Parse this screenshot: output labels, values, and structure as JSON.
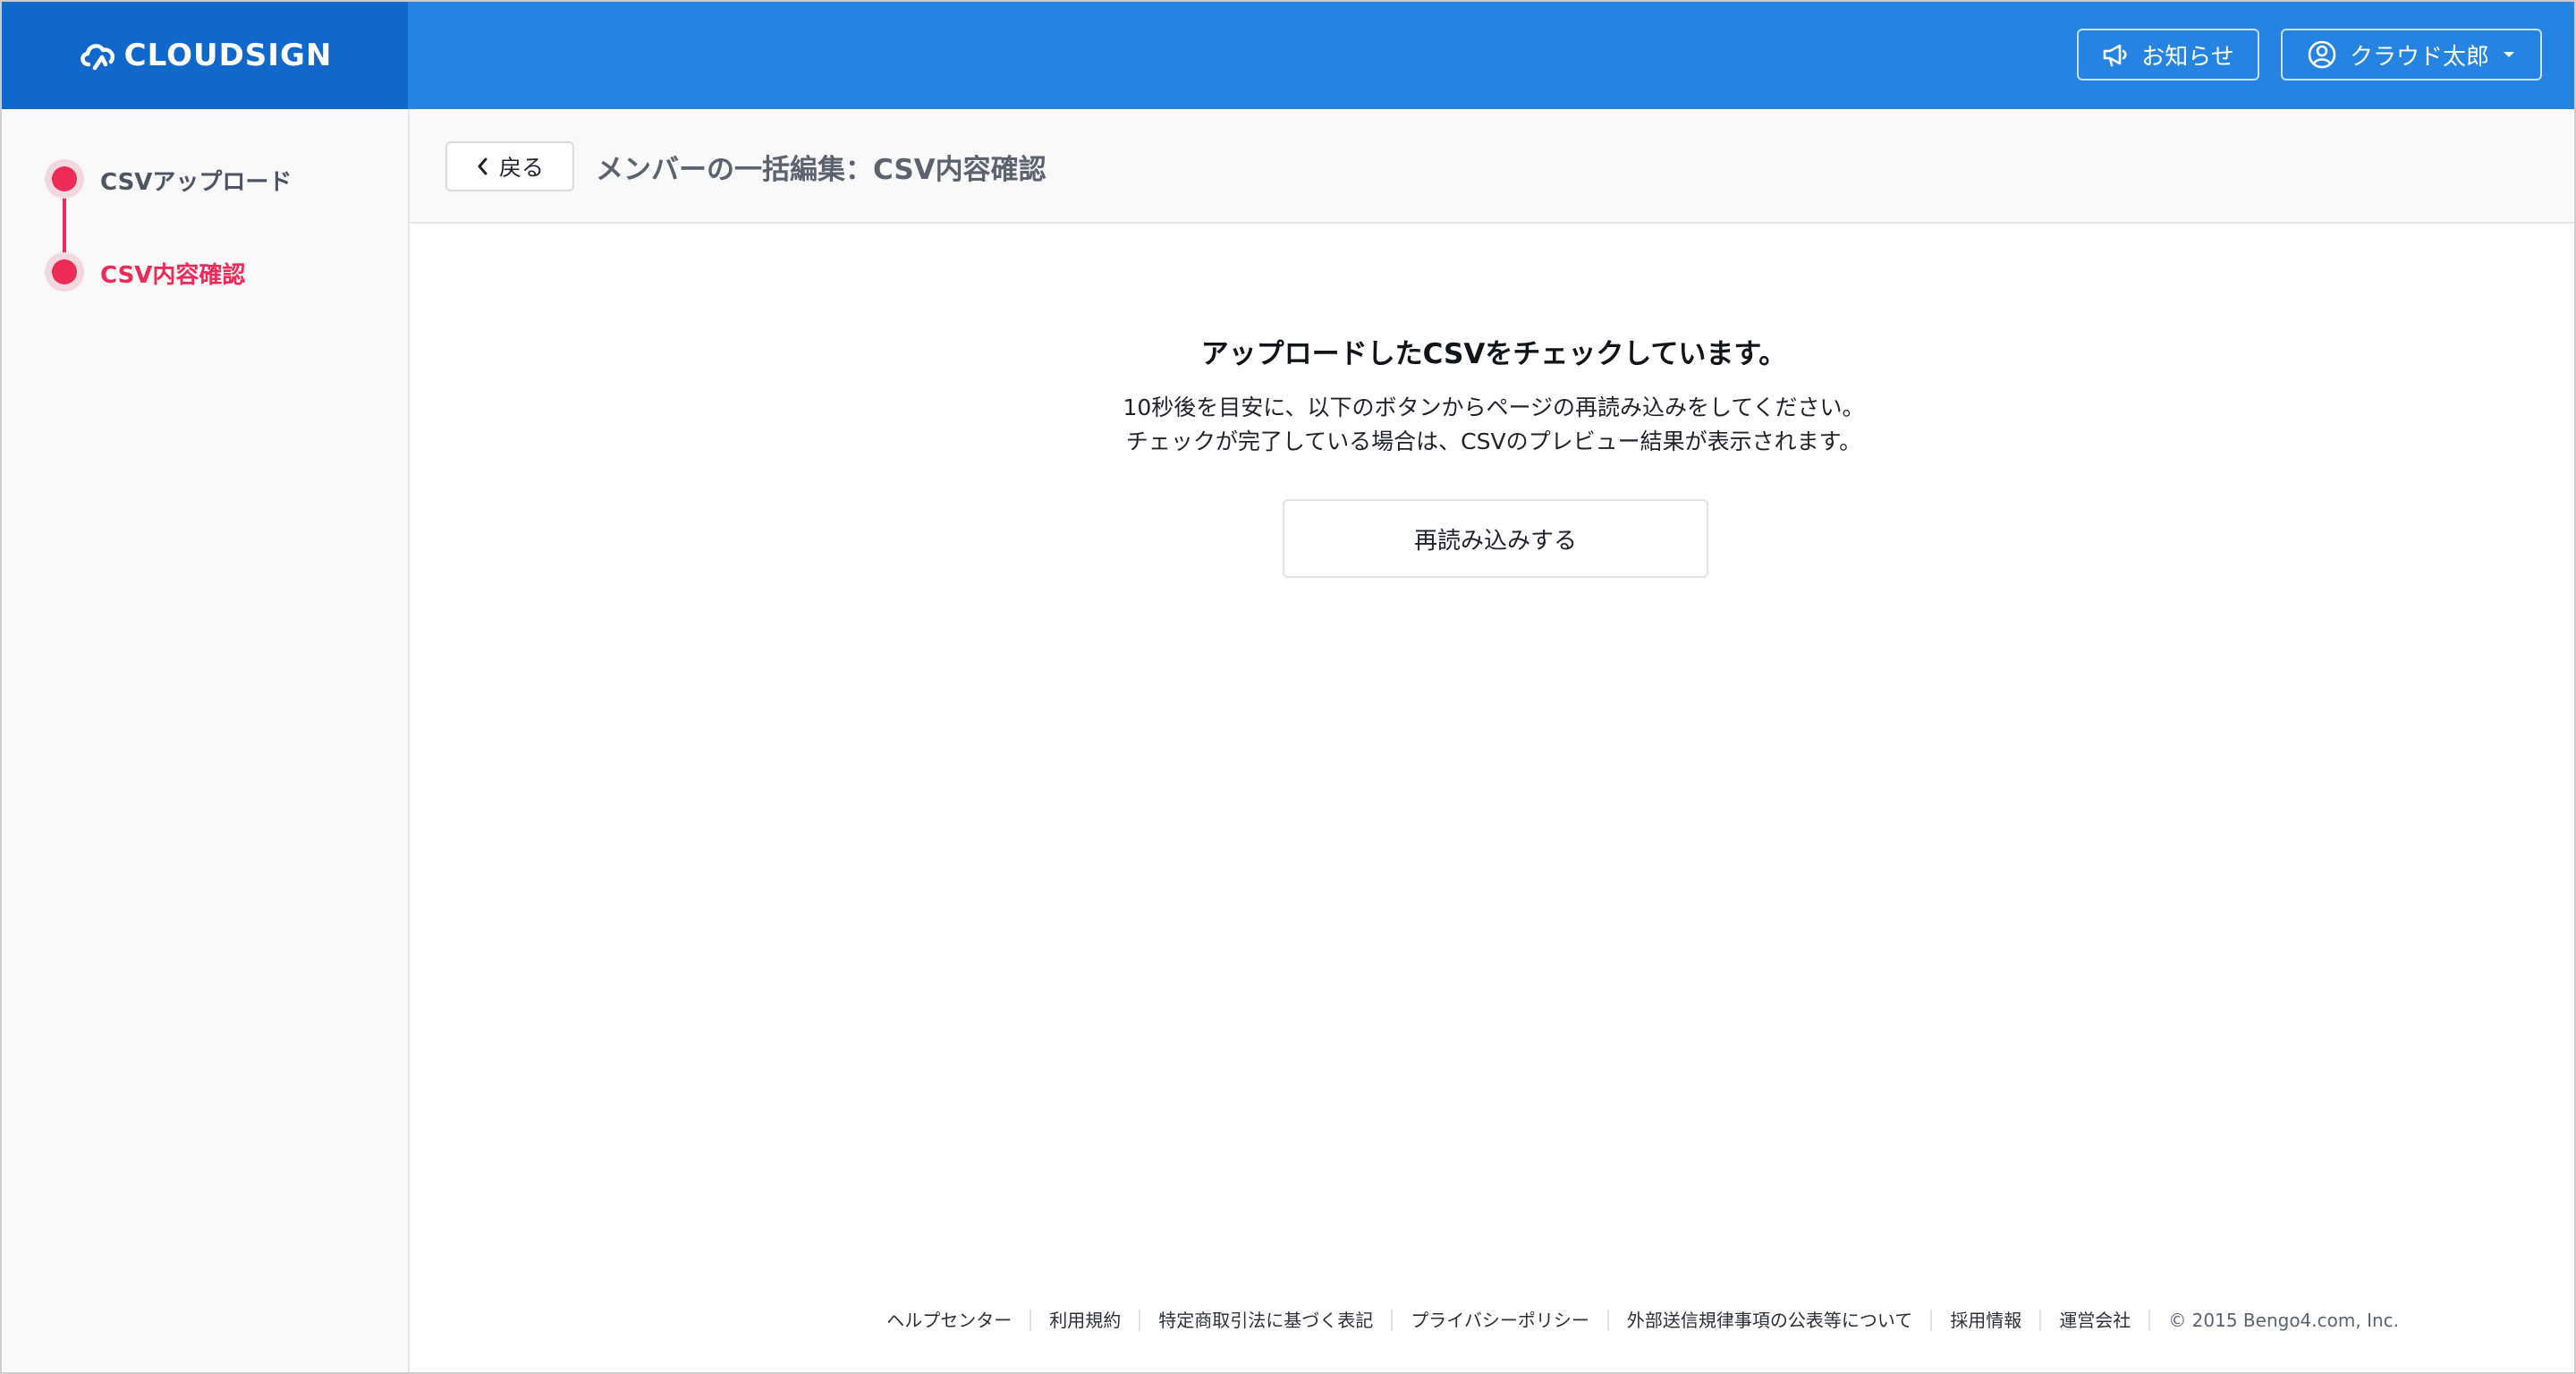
{
  "header": {
    "logo_text": "CLOUDSIGN",
    "notice_label": "お知らせ",
    "user_name": "クラウド太郎"
  },
  "sidebar": {
    "steps": [
      {
        "label": "CSVアップロード",
        "state": "done"
      },
      {
        "label": "CSV内容確認",
        "state": "current"
      }
    ]
  },
  "page": {
    "back_label": "戻る",
    "title": "メンバーの一括編集：CSV内容確認"
  },
  "main": {
    "heading": "アップロードしたCSVをチェックしています。",
    "line1": "10秒後を目安に、以下のボタンからページの再読み込みをしてください。",
    "line2": "チェックが完了している場合は、CSVのプレビュー結果が表示されます。",
    "reload_label": "再読み込みする"
  },
  "footer": {
    "links": [
      "ヘルプセンター",
      "利用規約",
      "特定商取引法に基づく表記",
      "プライバシーポリシー",
      "外部送信規律事項の公表等について",
      "採用情報",
      "運営会社"
    ],
    "copyright": "© 2015 Bengo4.com, Inc."
  },
  "colors": {
    "header_bg": "#2584e2",
    "logo_bg": "#0f68ca",
    "accent_pink": "#ec2b59"
  }
}
